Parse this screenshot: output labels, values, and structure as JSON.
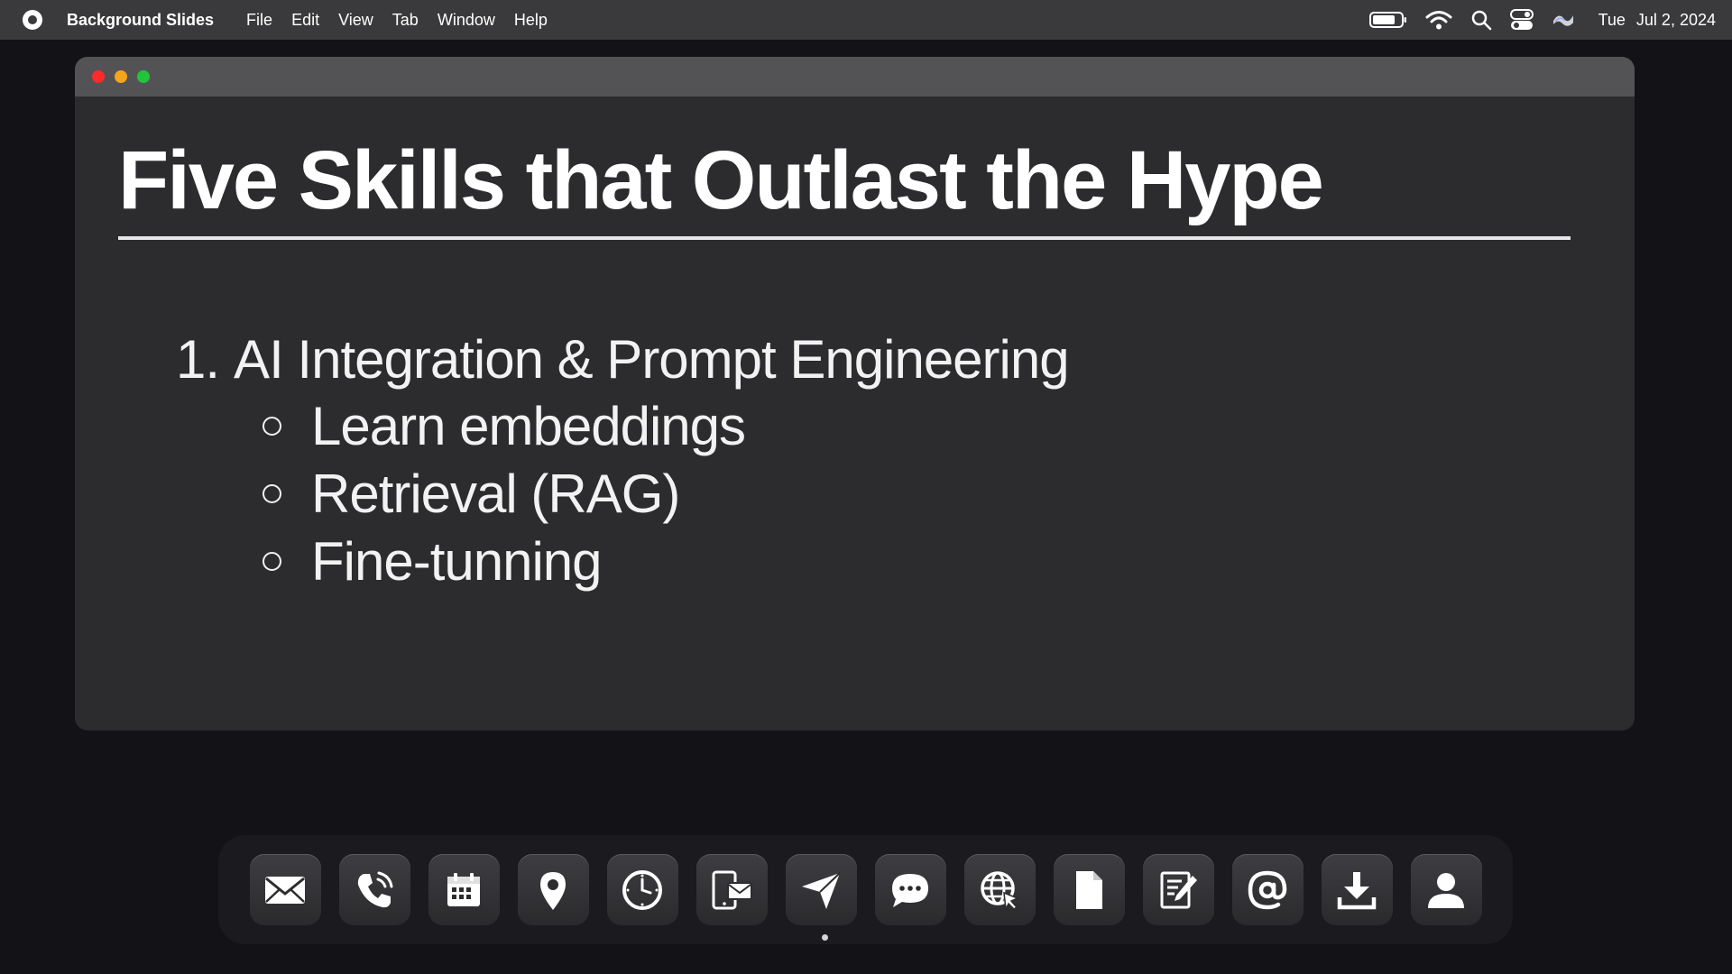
{
  "menubar": {
    "app_name": "Background Slides",
    "menus": [
      "File",
      "Edit",
      "View",
      "Tab",
      "Window",
      "Help"
    ],
    "clock_day": "Tue",
    "clock_date": "Jul 2, 2024",
    "status_icons": [
      "battery-icon",
      "wifi-icon",
      "search-icon",
      "control-center-icon",
      "siri-icon"
    ]
  },
  "window": {
    "traffic_lights": {
      "close": "#ff2b2b",
      "minimize": "#f3a51c",
      "maximize": "#22c43a"
    }
  },
  "slide": {
    "title": "Five Skills that Outlast the Hype",
    "point_number": "1.",
    "point_text": "AI Integration & Prompt Engineering",
    "sub_points": [
      "Learn embeddings",
      "Retrieval (RAG)",
      "Fine-tunning"
    ]
  },
  "dock": {
    "apps": [
      "mail",
      "phone",
      "calendar",
      "maps",
      "clock",
      "devices-mail",
      "send",
      "messages",
      "web-browser",
      "files",
      "notes",
      "contacts-at",
      "downloads",
      "account"
    ]
  }
}
